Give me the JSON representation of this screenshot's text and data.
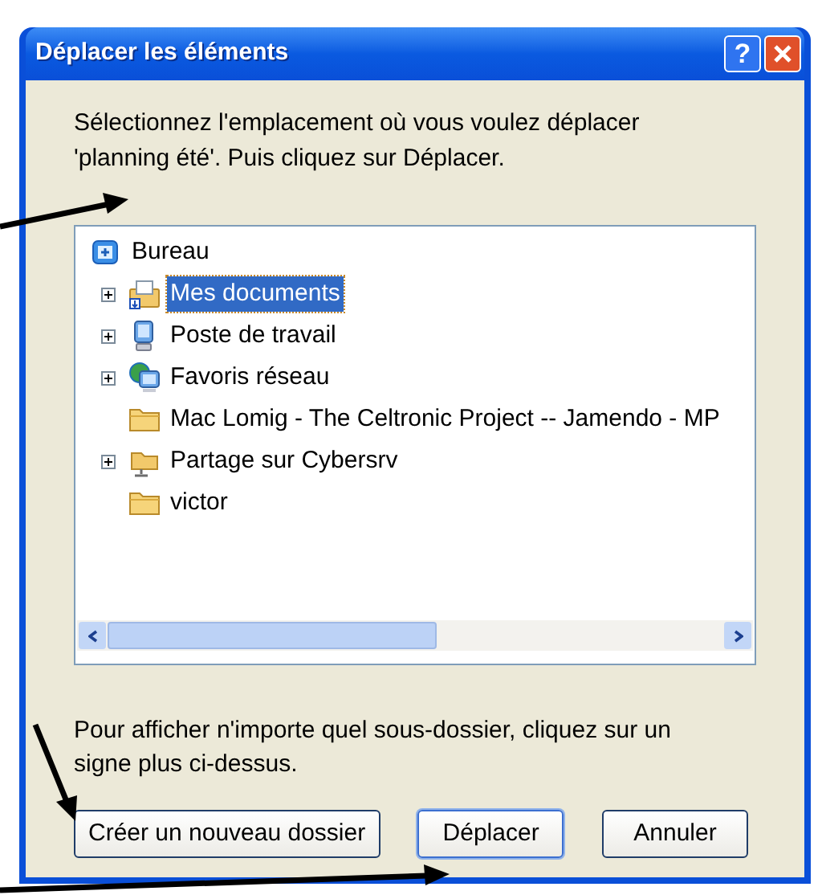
{
  "window": {
    "title": "Déplacer les éléments",
    "help_button": "?"
  },
  "instruction": "Sélectionnez l'emplacement où vous voulez déplacer 'planning été'. Puis cliquez sur Déplacer.",
  "tree": [
    {
      "label": "Bureau",
      "kind": "desktop",
      "expandable": false,
      "selected": false,
      "children": [
        {
          "label": "Mes documents",
          "kind": "documents",
          "expandable": true,
          "selected": true
        },
        {
          "label": "Poste de travail",
          "kind": "computer",
          "expandable": true,
          "selected": false
        },
        {
          "label": "Favoris réseau",
          "kind": "network",
          "expandable": true,
          "selected": false
        },
        {
          "label": "Mac Lomig - The Celtronic Project -- Jamendo - MP",
          "kind": "folder",
          "expandable": false,
          "selected": false
        },
        {
          "label": "Partage sur Cybersrv",
          "kind": "share",
          "expandable": true,
          "selected": false
        },
        {
          "label": "victor",
          "kind": "folder",
          "expandable": false,
          "selected": false
        }
      ]
    }
  ],
  "hint": "Pour afficher n'importe quel sous-dossier, cliquez sur un signe plus ci-dessus.",
  "buttons": [
    {
      "label": "Créer un nouveau dossier",
      "default": false
    },
    {
      "label": "Déplacer",
      "default": true
    },
    {
      "label": "Annuler",
      "default": false
    }
  ]
}
